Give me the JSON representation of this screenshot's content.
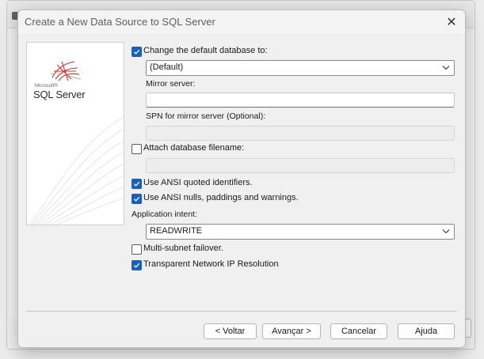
{
  "dialog": {
    "title": "Create a New Data Source to SQL Server",
    "close_glyph": "✕"
  },
  "banner": {
    "logo_sub": "Microsoft®",
    "logo_main": "SQL Server"
  },
  "form": {
    "change_db": {
      "label": "Change the default database to:",
      "checked": true
    },
    "default_db_value": "(Default)",
    "mirror_server_label": "Mirror server:",
    "mirror_server_value": "",
    "spn_label": "SPN for mirror server (Optional):",
    "spn_value": "",
    "attach_db": {
      "label": "Attach database filename:",
      "checked": false
    },
    "attach_db_value": "",
    "ansi_quoted": {
      "label": "Use ANSI quoted identifiers.",
      "checked": true
    },
    "ansi_nulls": {
      "label": "Use ANSI nulls, paddings and warnings.",
      "checked": true
    },
    "app_intent_label": "Application intent:",
    "app_intent_value": "READWRITE",
    "multi_subnet": {
      "label": "Multi-subnet failover.",
      "checked": false
    },
    "tnir": {
      "label": "Transparent Network IP Resolution",
      "checked": true
    }
  },
  "buttons": {
    "back": "< Voltar",
    "next": "Avançar >",
    "cancel": "Cancelar",
    "help": "Ajuda"
  },
  "colors": {
    "accent": "#1c5fb3",
    "logo_red": "#c8302c"
  }
}
